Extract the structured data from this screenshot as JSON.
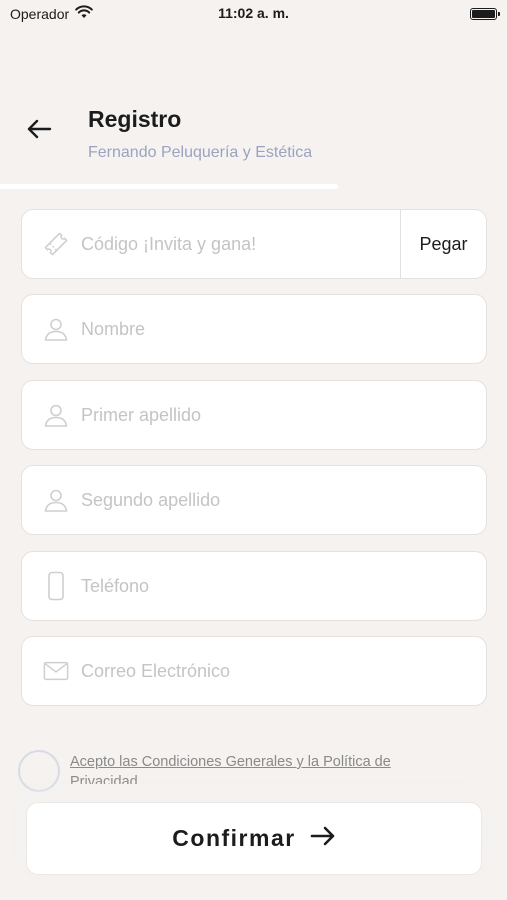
{
  "status_bar": {
    "carrier": "Operador",
    "time": "11:02 a. m.",
    "battery_level": 1.0
  },
  "header": {
    "title": "Registro",
    "subtitle": "Fernando Peluquería y Estética",
    "progress": 0.667
  },
  "form": {
    "invite_code": {
      "placeholder": "Código ¡Invita y gana!",
      "value": "",
      "paste_label": "Pegar",
      "icon": "ticket-icon"
    },
    "first_name": {
      "placeholder": "Nombre",
      "value": "",
      "icon": "user-icon"
    },
    "last_name_1": {
      "placeholder": "Primer apellido",
      "value": "",
      "icon": "user-icon"
    },
    "last_name_2": {
      "placeholder": "Segundo apellido",
      "value": "",
      "icon": "user-icon"
    },
    "phone": {
      "placeholder": "Teléfono",
      "value": "",
      "icon": "phone-icon"
    },
    "email": {
      "placeholder": "Correo Electrónico",
      "value": "",
      "icon": "mail-icon"
    }
  },
  "terms": {
    "label": "Acepto las Condiciones Generales y la Política de Privacidad",
    "checked": false
  },
  "confirm": {
    "label": "Confirmar"
  },
  "colors": {
    "background": "#f5f2f0",
    "subtitle": "#9aa3c0",
    "placeholder": "#c4c4c4"
  }
}
